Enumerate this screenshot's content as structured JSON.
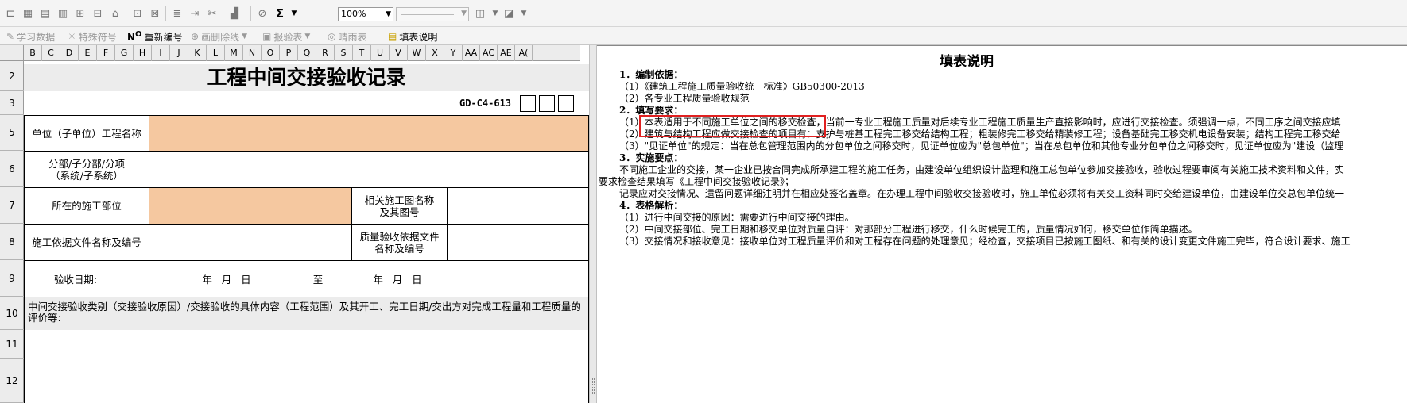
{
  "toolbar": {
    "zoom": "100%",
    "sum_icon": "Σ"
  },
  "toolbar2": {
    "items": [
      {
        "label": "学习数据",
        "icon": "✎",
        "enabled": false,
        "dropdown": false
      },
      {
        "label": "特殊符号",
        "icon": "☼",
        "enabled": false,
        "dropdown": false
      },
      {
        "label": "重新编号",
        "icon": "NO",
        "enabled": true,
        "dropdown": false
      },
      {
        "label": "画删除线",
        "icon": "⊕",
        "enabled": false,
        "dropdown": true
      },
      {
        "label": "报验表",
        "icon": "▣",
        "enabled": false,
        "dropdown": true
      },
      {
        "label": "晴雨表",
        "icon": "◎",
        "enabled": false,
        "dropdown": false
      },
      {
        "label": "填表说明",
        "icon": "▤",
        "enabled": true,
        "dropdown": false
      }
    ]
  },
  "sheet": {
    "columns": [
      "B",
      "C",
      "D",
      "E",
      "F",
      "G",
      "H",
      "I",
      "J",
      "K",
      "L",
      "M",
      "N",
      "O",
      "P",
      "Q",
      "R",
      "S",
      "T",
      "U",
      "V",
      "W",
      "X",
      "Y",
      "AA",
      "AC",
      "AE",
      "A("
    ],
    "rows": [
      "2",
      "3",
      "5",
      "6",
      "7",
      "8",
      "9",
      "10",
      "11",
      "12"
    ],
    "title": "工程中间交接验收记录",
    "form_code": "GD-C4-613",
    "labels": {
      "project_name": "单位（子单位）工程名称",
      "subitem": "分部/子分部/分项\n（系统/子系统）",
      "location": "所在的施工部位",
      "drawing": "相关施工图名称\n及其图号",
      "basis_doc": "施工依据文件名称及编号",
      "quality_doc": "质量验收依据文件\n名称及编号",
      "date_label": "验收日期:",
      "date_from": "年   月   日",
      "date_to_word": "至",
      "date_to": "年   月   日",
      "note": "中间交接验收类别（交接验收原因）/交接验收的具体内容（工程范围）及其开工、完工日期/交出方对完成工程量和工程质量的评价等:"
    }
  },
  "instructions": {
    "title": "填表说明",
    "lines": [
      {
        "text": "1．编制依据：",
        "bold": true,
        "indent": 0
      },
      {
        "text": "（1）《建筑工程施工质量验收统一标准》GB50300-2013",
        "bold": false,
        "indent": 0
      },
      {
        "text": "（2）各专业工程质量验收规范",
        "bold": false,
        "indent": 0
      },
      {
        "text": "2．填写要求：",
        "bold": true,
        "indent": 0
      },
      {
        "text": "（1）本表适用于不同施工单位之间的移交检查，当前一专业工程施工质量对后续专业工程施工质量生产直接影响时，应进行交接检查。须强调一点，不同工序之间交接应填",
        "bold": false,
        "indent": 0
      },
      {
        "text": "（2）建筑与结构工程应做交接检查的项目有：支护与桩基工程完工移交给结构工程；粗装修完工移交给精装修工程；设备基础完工移交机电设备安装；结构工程完工移交给",
        "bold": false,
        "indent": 0
      },
      {
        "text": "（3）\"见证单位\"的规定：当在总包管理范围内的分包单位之间移交时，见证单位应为\"总包单位\"；当在总包单位和其他专业分包单位之间移交时，见证单位应为\"建设（监理",
        "bold": false,
        "indent": 0
      },
      {
        "text": "3．实施要点：",
        "bold": true,
        "indent": 0
      },
      {
        "text": "不同施工企业的交接，某一企业已按合同完成所承建工程的施工任务，由建设单位组织设计监理和施工总包单位参加交接验收，验收过程要审阅有关施工技术资料和文件，实",
        "bold": false,
        "indent": 1
      },
      {
        "text": "要求检查结果填写《工程中间交接验收记录》；",
        "bold": false,
        "indent": -1
      },
      {
        "text": "记录应对交接情况、遗留问题详细注明并在相应处签名盖章。在办理工程中间验收交接验收时，施工单位必须将有关交工资料同时交给建设单位，由建设单位交总包单位统一",
        "bold": false,
        "indent": 1
      },
      {
        "text": "4．表格解析：",
        "bold": true,
        "indent": 0
      },
      {
        "text": "（1）进行中间交接的原因：需要进行中间交接的理由。",
        "bold": false,
        "indent": 0
      },
      {
        "text": "（2）中间交接部位、完工日期和移交单位对质量自评：对那部分工程进行移交，什么时候完工的，质量情况如何，移交单位作简单描述。",
        "bold": false,
        "indent": 0
      },
      {
        "text": "（3）交接情况和接收意见：接收单位对工程质量评价和对工程存在问题的处理意见；经检查，交接项目已按施工图纸、和有关的设计变更文件施工完毕，符合设计要求、施工",
        "bold": false,
        "indent": 0
      }
    ]
  },
  "colors": {
    "highlight_box": "#e02020",
    "input_fill": "#f5c8a0"
  }
}
